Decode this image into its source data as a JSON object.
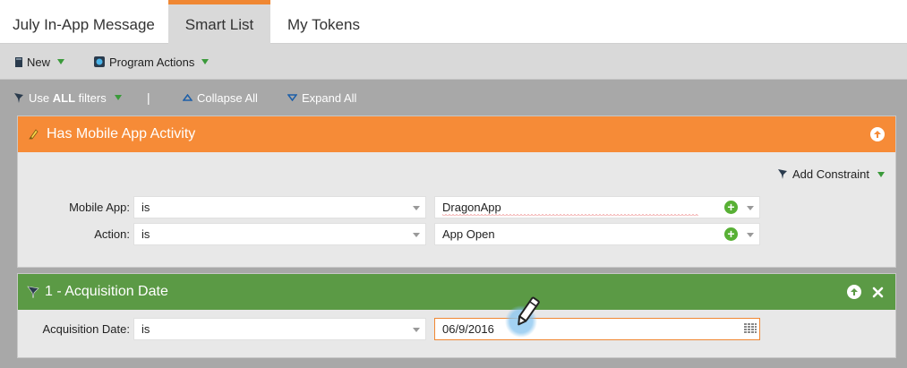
{
  "tabs": [
    {
      "label": "July In-App Message",
      "active": false
    },
    {
      "label": "Smart List",
      "active": true
    },
    {
      "label": "My Tokens",
      "active": false
    }
  ],
  "toolbar": {
    "new_label": "New",
    "program_actions_label": "Program Actions"
  },
  "filterbar": {
    "use_prefix": "Use",
    "use_all": "ALL",
    "use_suffix": "filters",
    "separator": "|",
    "collapse_all": "Collapse All",
    "expand_all": "Expand All"
  },
  "filters": [
    {
      "title": "Has Mobile App Activity",
      "color": "#f68b37",
      "add_constraint": "Add Constraint",
      "rows": [
        {
          "label": "Mobile App:",
          "operator": "is",
          "value": "DragonApp"
        },
        {
          "label": "Action:",
          "operator": "is",
          "value": "App Open"
        }
      ]
    },
    {
      "title": "1 - Acquisition Date",
      "color": "#5b9a45",
      "rows": [
        {
          "label": "Acquisition Date:",
          "operator": "is",
          "value": "06/9/2016"
        }
      ]
    }
  ],
  "colors": {
    "accent": "#f08732",
    "orange_header": "#f68b37",
    "green_header": "#5b9a45",
    "add_green": "#58b035"
  }
}
